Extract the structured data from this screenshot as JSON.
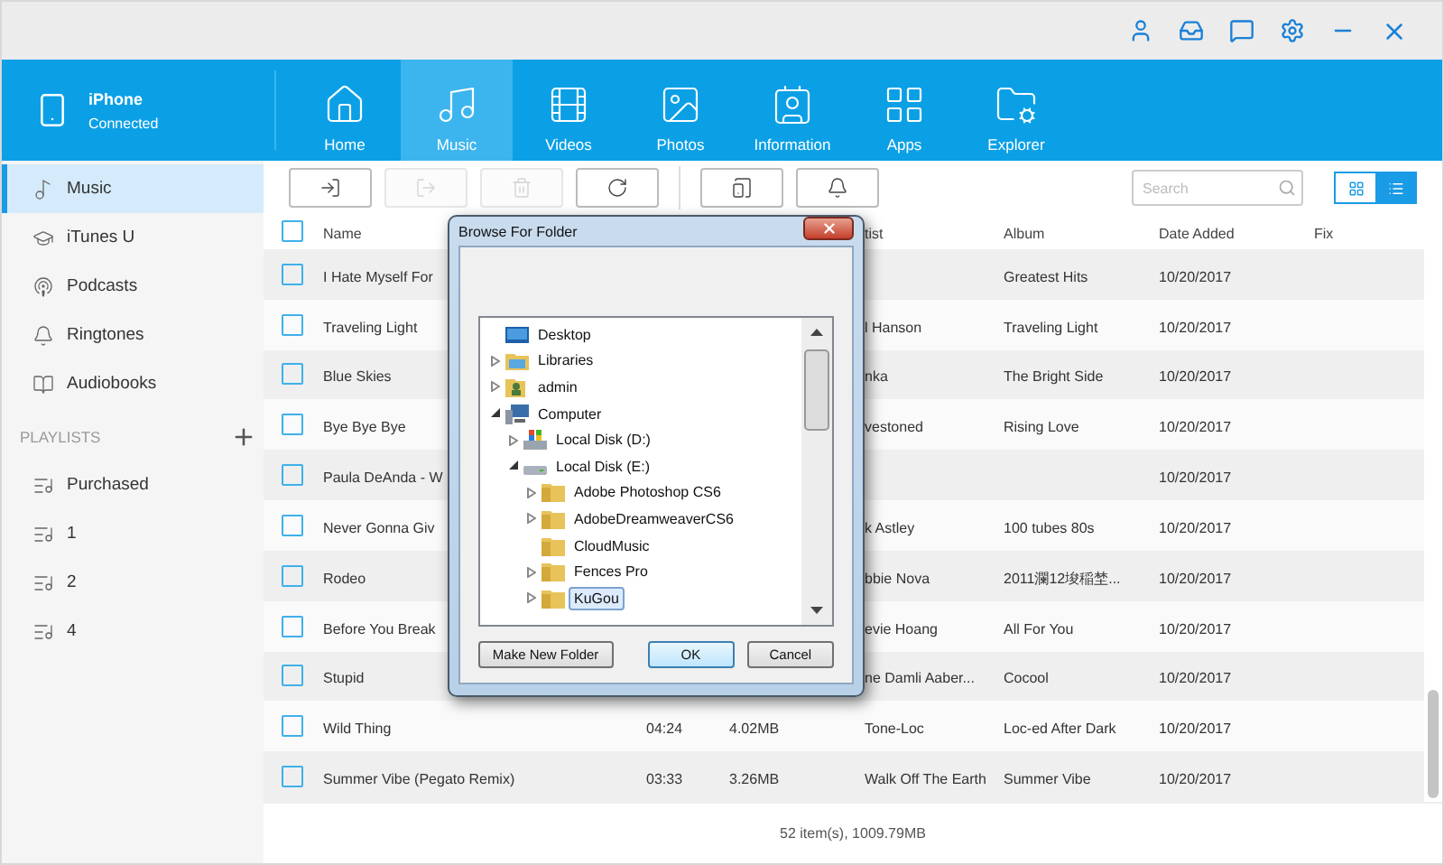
{
  "device": {
    "name": "iPhone",
    "status": "Connected"
  },
  "nav": [
    {
      "label": "Home",
      "kind": "home",
      "selected": false
    },
    {
      "label": "Music",
      "kind": "music",
      "selected": true
    },
    {
      "label": "Videos",
      "kind": "videos",
      "selected": false
    },
    {
      "label": "Photos",
      "kind": "photos",
      "selected": false
    },
    {
      "label": "Information",
      "kind": "information",
      "selected": false
    },
    {
      "label": "Apps",
      "kind": "apps",
      "selected": false
    },
    {
      "label": "Explorer",
      "kind": "explorer",
      "selected": false
    }
  ],
  "sidebar": {
    "items": [
      {
        "label": "Music",
        "kind": "music",
        "selected": true
      },
      {
        "label": "iTunes U",
        "kind": "itunesu",
        "selected": false
      },
      {
        "label": "Podcasts",
        "kind": "podcasts",
        "selected": false
      },
      {
        "label": "Ringtones",
        "kind": "ringtones",
        "selected": false
      },
      {
        "label": "Audiobooks",
        "kind": "audiobooks",
        "selected": false
      }
    ],
    "playlists_heading": "PLAYLISTS",
    "playlists": [
      {
        "label": "Purchased",
        "selected": false
      },
      {
        "label": "1",
        "selected": false
      },
      {
        "label": "2",
        "selected": false
      },
      {
        "label": "4",
        "selected": false
      }
    ]
  },
  "toolbar": {
    "buttons": [
      {
        "kind": "import",
        "disabled": false
      },
      {
        "kind": "export",
        "disabled": true
      },
      {
        "kind": "delete",
        "disabled": true
      },
      {
        "kind": "refresh",
        "disabled": false
      },
      {
        "kind": "device",
        "disabled": false
      },
      {
        "kind": "ringtone",
        "disabled": false
      }
    ],
    "search": {
      "placeholder": "Search"
    },
    "views": [
      {
        "kind": "grid",
        "selected": false
      },
      {
        "kind": "list",
        "selected": true
      }
    ]
  },
  "table": {
    "all_checked": false,
    "header": {
      "name": "Name",
      "artist": "tist",
      "album": "Album",
      "date": "Date Added",
      "fix": "Fix"
    },
    "rows": [
      {
        "checked": false,
        "name": "I Hate Myself For",
        "album": "Greatest Hits",
        "date": "10/20/2017"
      },
      {
        "checked": false,
        "name": "Traveling Light",
        "artist": "l Hanson",
        "album": "Traveling Light",
        "date": "10/20/2017"
      },
      {
        "checked": false,
        "name": "Blue Skies",
        "artist": "nka",
        "album": "The Bright Side",
        "date": "10/20/2017"
      },
      {
        "checked": false,
        "name": "Bye Bye Bye",
        "artist": "vestoned",
        "album": "Rising Love",
        "date": "10/20/2017"
      },
      {
        "checked": false,
        "name": "Paula DeAnda - W",
        "date": "10/20/2017"
      },
      {
        "checked": false,
        "name": "Never Gonna Giv",
        "artist": "k Astley",
        "album": "100 tubes 80s",
        "date": "10/20/2017"
      },
      {
        "checked": false,
        "name": "Rodeo",
        "artist": "bbie Nova",
        "album": "2011瀾12埈稲埜...",
        "date": "10/20/2017"
      },
      {
        "checked": false,
        "name": "Before You Break",
        "artist": "evie Hoang",
        "album": "All For You",
        "date": "10/20/2017"
      },
      {
        "checked": false,
        "name": "Stupid",
        "artist": "ne Damli Aaber...",
        "album": "Cocool",
        "date": "10/20/2017"
      },
      {
        "checked": false,
        "name": "Wild Thing",
        "time": "04:24",
        "size": "4.02MB",
        "artist": "Tone-Loc",
        "album": "Loc-ed After Dark",
        "date": "10/20/2017"
      },
      {
        "checked": false,
        "name": "Summer Vibe (Pegato Remix)",
        "time": "03:33",
        "size": "3.26MB",
        "artist": "Walk Off The Earth",
        "album": "Summer Vibe",
        "date": "10/20/2017"
      }
    ]
  },
  "status_bar": "52 item(s), 1009.79MB",
  "dialog": {
    "title": "Browse For Folder",
    "tree": [
      {
        "label": "Desktop",
        "kind": "desktop",
        "selected": false
      },
      {
        "label": "Libraries",
        "kind": "library",
        "selected": false,
        "expanded": false
      },
      {
        "label": "admin",
        "kind": "user",
        "selected": false,
        "expanded": false
      },
      {
        "label": "Computer",
        "kind": "computer",
        "selected": false,
        "expanded": true,
        "children": [
          {
            "label": "Local Disk (D:)",
            "kind": "system-drive",
            "selected": false,
            "expanded": false
          },
          {
            "label": "Local Disk (E:)",
            "kind": "drive",
            "selected": false,
            "expanded": true,
            "children": [
              {
                "label": "Adobe Photoshop CS6",
                "kind": "folder",
                "selected": false,
                "expanded": false
              },
              {
                "label": "AdobeDreamweaverCS6",
                "kind": "folder",
                "selected": false,
                "expanded": false
              },
              {
                "label": "CloudMusic",
                "kind": "folder",
                "selected": false
              },
              {
                "label": "Fences Pro",
                "kind": "folder",
                "selected": false,
                "expanded": false
              },
              {
                "label": "KuGou",
                "kind": "folder",
                "selected": true,
                "expanded": false
              }
            ]
          }
        ]
      }
    ],
    "buttons": [
      {
        "label": "Make New Folder",
        "default": false
      },
      {
        "label": "OK",
        "default": true
      },
      {
        "label": "Cancel",
        "default": false
      }
    ]
  }
}
